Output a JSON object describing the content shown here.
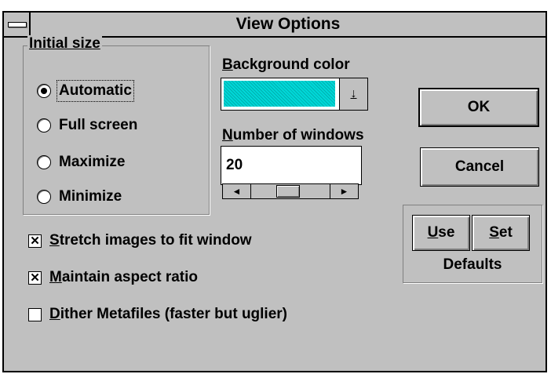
{
  "window": {
    "title": "View Options"
  },
  "initial_size": {
    "legend": "Initial size",
    "options": [
      "Automatic",
      "Full screen",
      "Maximize",
      "Minimize"
    ],
    "selected": "Automatic"
  },
  "background_color": {
    "label_first": "B",
    "label_rest": "ackground color",
    "value_color": "#00c8c8",
    "drop_glyph": "↓"
  },
  "number_of_windows": {
    "label_first": "N",
    "label_rest": "umber of windows",
    "value": "20",
    "scroll_left": "◄",
    "scroll_right": "►"
  },
  "checkboxes": [
    {
      "first": "S",
      "rest": "tretch images to fit window",
      "checked": true,
      "mark": "✕"
    },
    {
      "first": "M",
      "rest": "aintain aspect ratio",
      "checked": true,
      "mark": "✕"
    },
    {
      "first": "D",
      "rest": "ither Metafiles (faster but uglier)",
      "checked": false,
      "mark": ""
    }
  ],
  "buttons": {
    "ok": "OK",
    "cancel": "Cancel",
    "use_first": "U",
    "use_rest": "se",
    "set_first": "S",
    "set_rest": "et",
    "defaults_label": "Defaults"
  }
}
